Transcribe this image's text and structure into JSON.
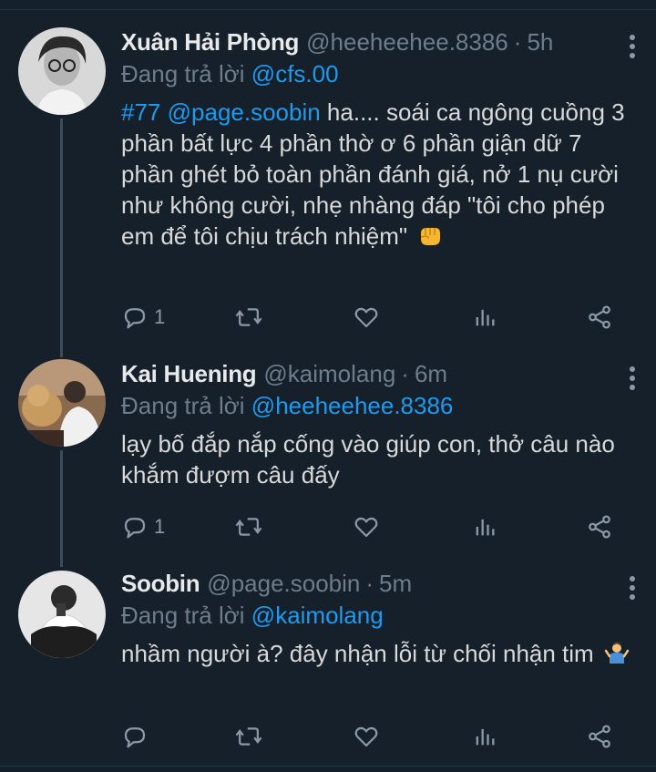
{
  "thread": {
    "tweets": [
      {
        "name": "Xuân Hải Phòng",
        "handle": "@heeheehee.8386",
        "time": "5h",
        "replying_label": "Đang trả lời",
        "replying_to": "@cfs.00",
        "hashtag": "#77",
        "mention": "@page.soobin",
        "text": " ha.... soái ca ngông cuồng 3 phần bất lực 4 phần thờ ơ 6 phần giận dữ 7 phần ghét bỏ toàn phần đánh giá, nở 1 nụ cười như không cười, nhẹ nhàng đáp \"tôi cho phép em để tôi chịu trách nhiệm\"",
        "emoji": "fist-emoji",
        "reply_count": "1",
        "avatar": "avatar-glasses-man"
      },
      {
        "name": "Kai Huening",
        "handle": "@kaimolang",
        "time": "6m",
        "replying_label": "Đang trả lời",
        "replying_to": "@heeheehee.8386",
        "text": "lạy bố đắp nắp cống vào giúp con, thở câu nào khắm đượm câu đấy",
        "reply_count": "1",
        "avatar": "avatar-man-with-dog"
      },
      {
        "name": "Soobin",
        "handle": "@page.soobin",
        "time": "5m",
        "replying_label": "Đang trả lời",
        "replying_to": "@kaimolang",
        "text": "nhầm người à? đây nhận lỗi từ chối nhận tim",
        "emoji": "shrug-emoji",
        "reply_count": "",
        "avatar": "avatar-sitting-man"
      }
    ]
  },
  "icons": {
    "reply": "reply-icon",
    "retweet": "retweet-icon",
    "like": "heart-icon",
    "views": "analytics-icon",
    "share": "share-icon",
    "more": "more-icon"
  },
  "colors": {
    "background": "#15202b",
    "link": "#1d9bf0",
    "muted": "#6e7d8b",
    "thread_line": "#3d4c5a"
  }
}
